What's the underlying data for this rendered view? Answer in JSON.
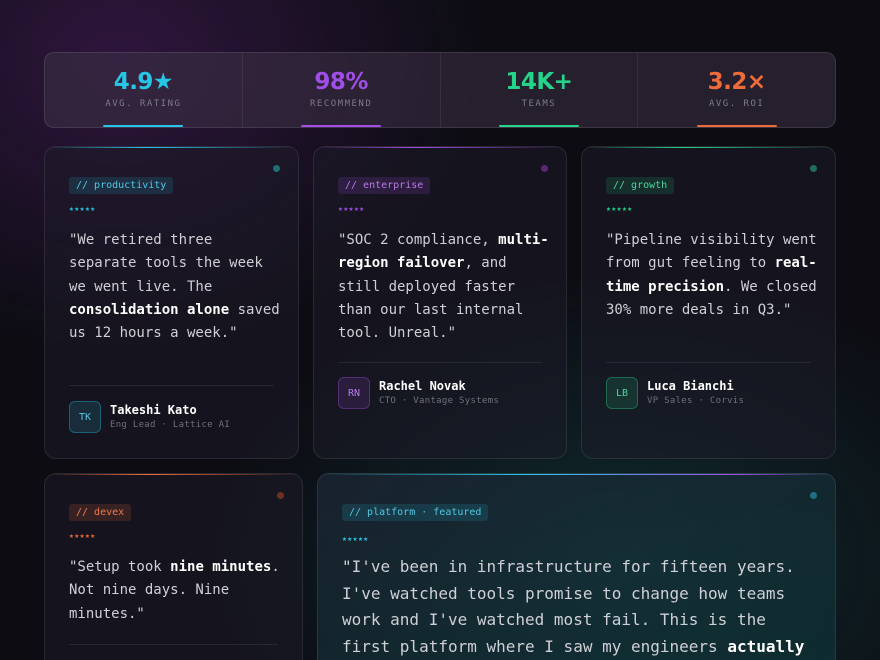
{
  "stats": [
    {
      "value": "4.9★",
      "label": "AVG. RATING",
      "color": "#27c6e6"
    },
    {
      "value": "98%",
      "label": "RECOMMEND",
      "color": "#a14ee8"
    },
    {
      "value": "14K+",
      "label": "TEAMS",
      "color": "#25d38a"
    },
    {
      "value": "3.2×",
      "label": "AVG. ROI",
      "color": "#f06a3a"
    }
  ],
  "testimonials": [
    {
      "tag": "// productivity",
      "stars": "★★★★★",
      "quote_parts": [
        "\"We retired three separate tools the week we went live. The ",
        "consolidation alone",
        " saved us 12 hours a week.\""
      ],
      "initials": "TK",
      "name": "Takeshi Kato",
      "role": "Eng Lead · Lattice AI"
    },
    {
      "tag": "// enterprise",
      "stars": "★★★★★",
      "quote_parts": [
        "\"SOC 2 compliance, ",
        "multi-region failover",
        ", and still deployed faster than our last internal tool. Unreal.\""
      ],
      "initials": "RN",
      "name": "Rachel Novak",
      "role": "CTO · Vantage Systems"
    },
    {
      "tag": "// growth",
      "stars": "★★★★★",
      "quote_parts": [
        "\"Pipeline visibility went from gut feeling to ",
        "real-time precision",
        ". We closed 30% more deals in Q3.\""
      ],
      "initials": "LB",
      "name": "Luca Bianchi",
      "role": "VP Sales · Corvis"
    },
    {
      "tag": "// devex",
      "stars": "★★★★★",
      "quote_parts": [
        "\"Setup took ",
        "nine minutes",
        ". Not nine days. Nine minutes.\""
      ]
    },
    {
      "tag": "// platform · featured",
      "stars": "★★★★★",
      "quote_parts": [
        "\"I've been in infrastructure for fifteen years. I've watched tools promise to change how teams work and I've watched most fail. This is the first platform where I saw my engineers ",
        "actually"
      ]
    }
  ]
}
